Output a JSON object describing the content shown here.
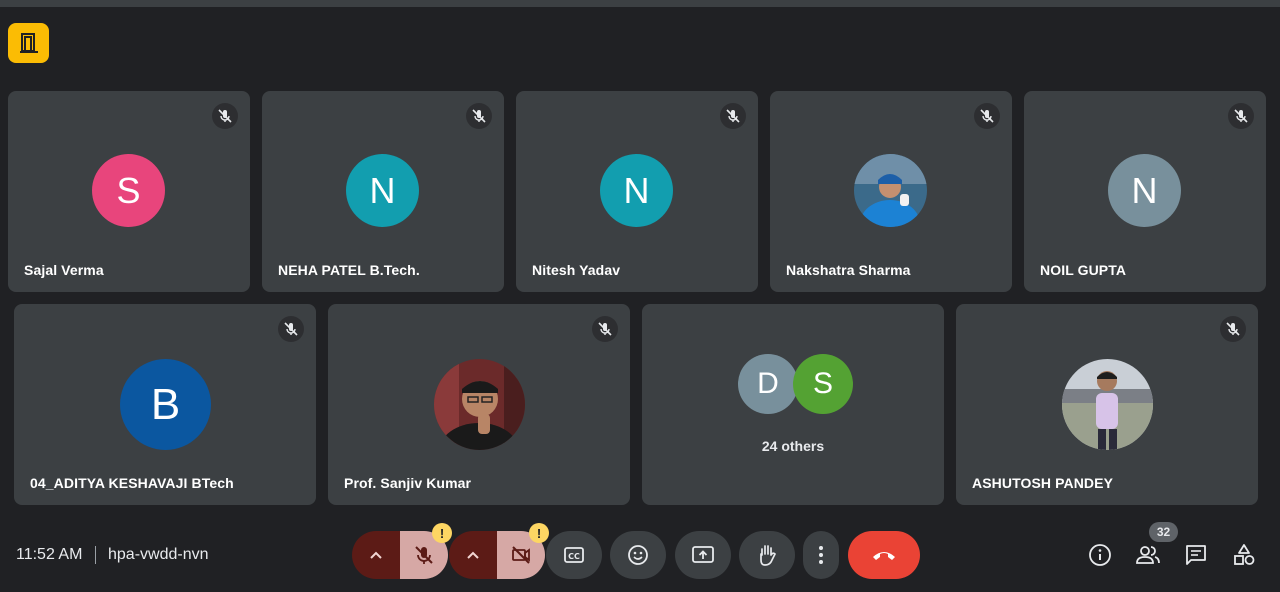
{
  "colors": {
    "background": "#202124",
    "tile": "#3c4043",
    "hangup": "#ea4335",
    "muted_control": "#d6a8a5",
    "caret_control": "#5c1b16",
    "warning": "#fdd663",
    "app_badge": "#fbbc04"
  },
  "app_badge_icon": "door-icon",
  "row1": [
    {
      "name": "Sajal Verma",
      "initial": "S",
      "avatar_color": "#e8457c",
      "muted": true
    },
    {
      "name": "NEHA PATEL B.Tech.",
      "initial": "N",
      "avatar_color": "#129eaf",
      "muted": true
    },
    {
      "name": "Nitesh Yadav",
      "initial": "N",
      "avatar_color": "#129eaf",
      "muted": true
    },
    {
      "name": "Nakshatra Sharma",
      "avatar_photo": "cricketer-photo",
      "muted": true
    },
    {
      "name": "NOIL GUPTA",
      "initial": "N",
      "avatar_color": "#78909c",
      "muted": true
    }
  ],
  "row2": [
    {
      "name": "04_ADITYA KESHAVAJI BTech",
      "initial": "B",
      "avatar_color": "#0b57a0",
      "muted": true
    },
    {
      "name": "Prof. Sanjiv Kumar",
      "avatar_photo": "man-with-glasses-photo",
      "muted": true
    },
    {
      "others_label": "24 others",
      "initials": [
        "D",
        "S"
      ],
      "avatar_colors": [
        "#78909c",
        "#54a233"
      ]
    },
    {
      "name": "ASHUTOSH PANDEY",
      "avatar_photo": "man-outdoors-photo",
      "muted": true
    }
  ],
  "bottom": {
    "time": "11:52 AM",
    "meeting_code": "hpa-vwdd-nvn",
    "warning_mark": "!",
    "participant_count": "32",
    "controls": [
      "mic-options",
      "microphone-off",
      "camera-options",
      "camera-off",
      "captions",
      "reactions",
      "present-screen",
      "raise-hand",
      "more-options",
      "leave-call"
    ],
    "right_icons": [
      "meeting-details",
      "people",
      "chat",
      "activities"
    ]
  }
}
